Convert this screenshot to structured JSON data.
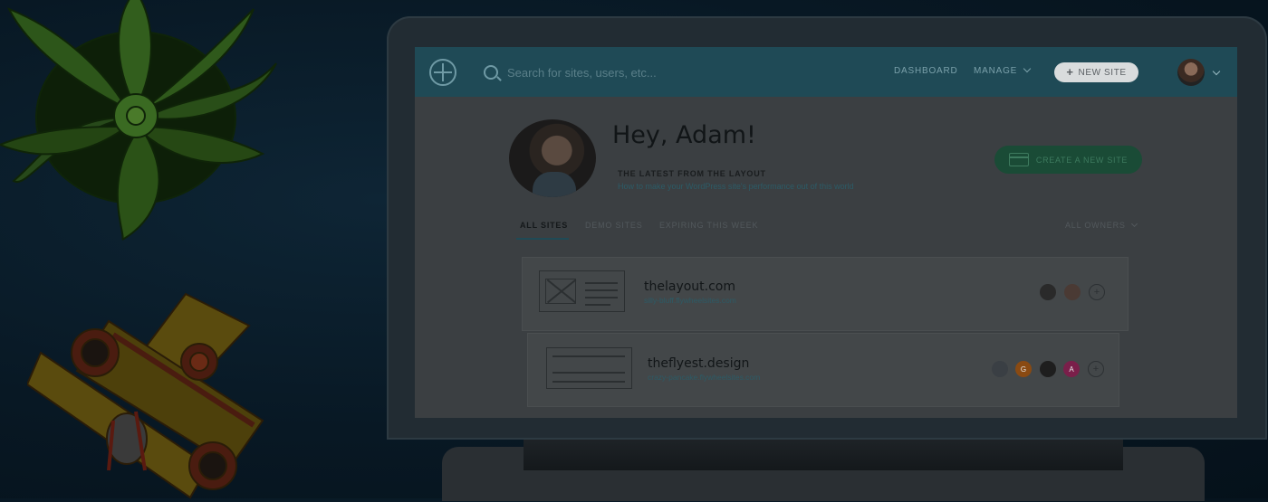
{
  "header": {
    "search_placeholder": "Search for sites, users, etc...",
    "nav_dashboard": "DASHBOARD",
    "nav_manage": "MANAGE",
    "new_site_label": "NEW SITE"
  },
  "profile": {
    "greeting": "Hey, Adam!",
    "latest_title": "THE LATEST FROM THE LAYOUT",
    "latest_link": "How to make your WordPress site's performance out of this world",
    "create_button": "CREATE A NEW SITE"
  },
  "tabs": [
    {
      "label": "ALL SITES",
      "active": true
    },
    {
      "label": "DEMO SITES",
      "active": false
    },
    {
      "label": "EXPIRING THIS WEEK",
      "active": false
    }
  ],
  "owners_filter": "ALL OWNERS",
  "sites": [
    {
      "name": "thelayout.com",
      "url": "silly-bluff.flywheelsites.com",
      "owners": [
        "avatar",
        "avatar"
      ]
    },
    {
      "name": "theflyest.design",
      "url": "crazy-pancake.flywheelsites.com",
      "owners": [
        "avatar",
        "G",
        "avatar",
        "A"
      ]
    }
  ],
  "colors": {
    "header_teal": "#1f4a56",
    "create_green": "#1a4b36",
    "link_teal": "#2c5b66",
    "owner_orange": "#8a4a12",
    "owner_pink": "#7a1f4a"
  }
}
